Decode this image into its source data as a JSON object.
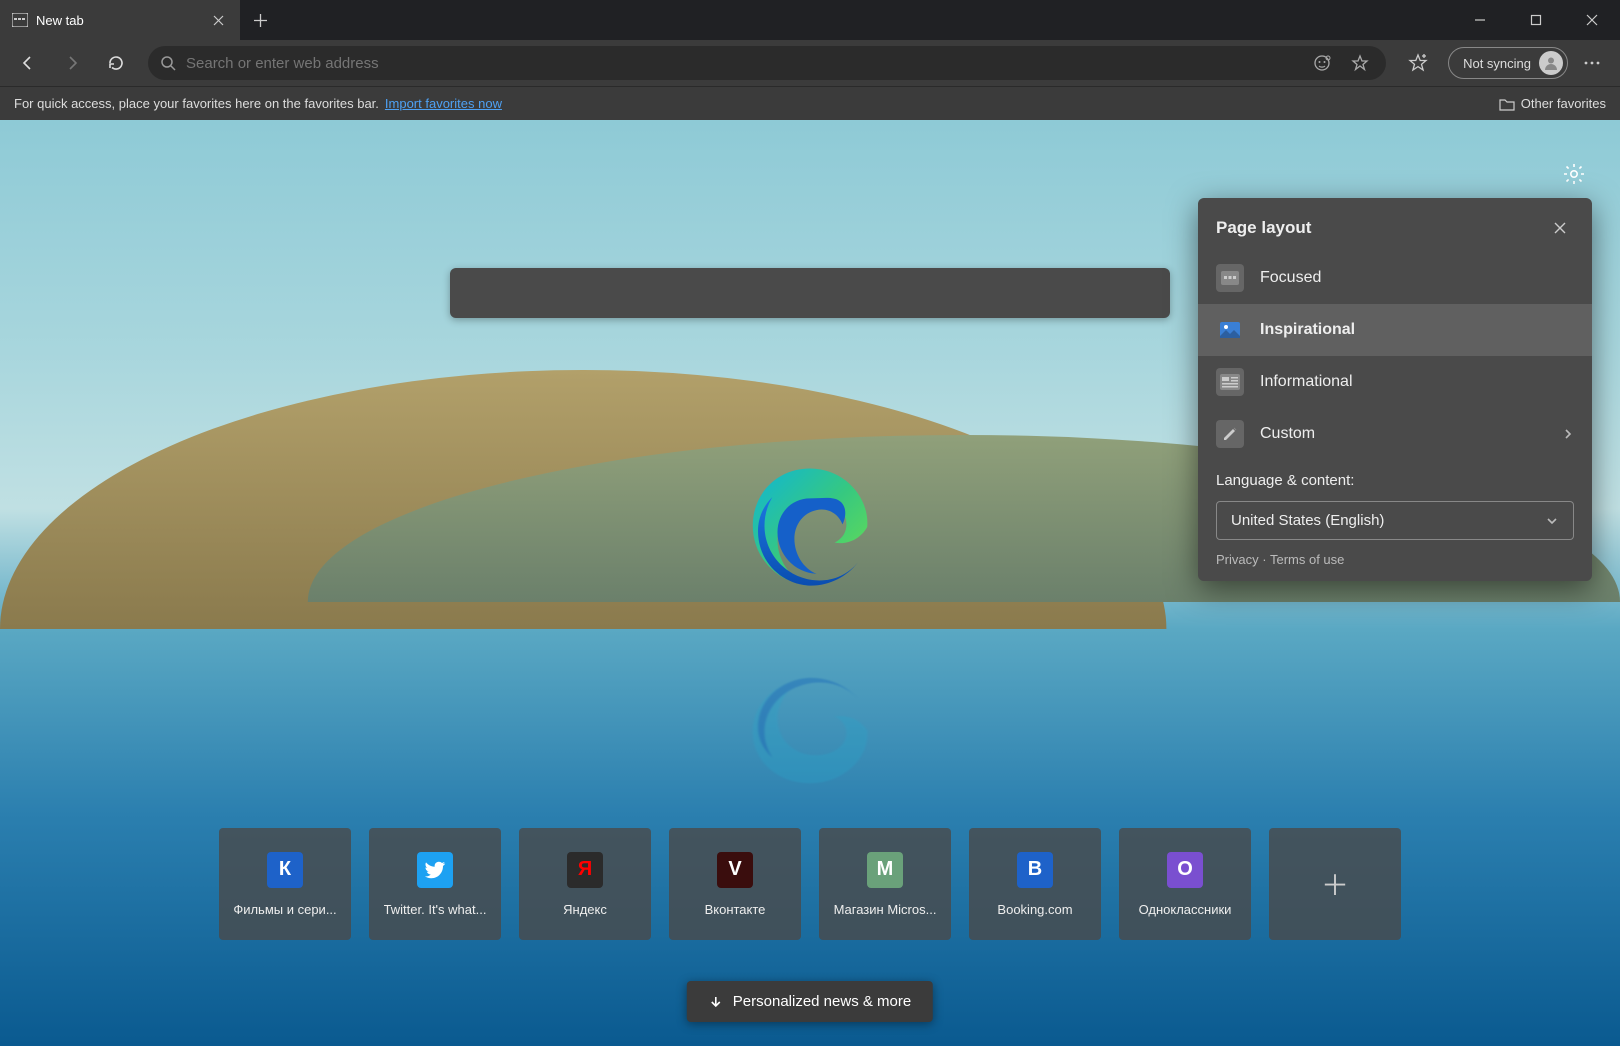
{
  "tab": {
    "title": "New tab"
  },
  "toolbar": {
    "search_placeholder": "Search or enter web address",
    "sync_label": "Not syncing"
  },
  "favbar": {
    "hint": "For quick access, place your favorites here on the favorites bar.",
    "import_label": "Import favorites now",
    "other_label": "Other favorites"
  },
  "tiles": [
    {
      "label": "Фильмы и сери...",
      "letter": "К",
      "color": "#1e62c9"
    },
    {
      "label": "Twitter. It's what...",
      "letter": "",
      "color": "#1da1f2",
      "icon": "twitter"
    },
    {
      "label": "Яндекс",
      "letter": "Я",
      "color": "#2b2b2b",
      "fg": "#ff0000"
    },
    {
      "label": "Вконтакте",
      "letter": "V",
      "color": "#3a0d0d"
    },
    {
      "label": "Магазин Micros...",
      "letter": "М",
      "color": "#6aa17a"
    },
    {
      "label": "Booking.com",
      "letter": "В",
      "color": "#1e62c9"
    },
    {
      "label": "Одноклассники",
      "letter": "О",
      "color": "#7a4fd0"
    }
  ],
  "news_label": "Personalized news & more",
  "panel": {
    "title": "Page layout",
    "options": [
      {
        "label": "Focused"
      },
      {
        "label": "Inspirational",
        "selected": true
      },
      {
        "label": "Informational"
      },
      {
        "label": "Custom",
        "chevron": true
      }
    ],
    "lang_label": "Language & content:",
    "lang_value": "United States (English)",
    "privacy": "Privacy",
    "terms": "Terms of use"
  }
}
